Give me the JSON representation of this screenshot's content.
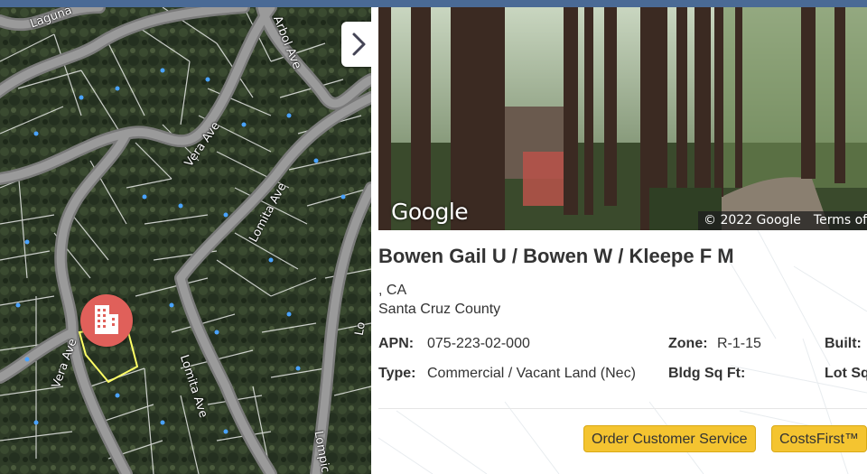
{
  "map": {
    "road_labels": [
      "Laguna",
      "Arbol Ave",
      "Vera Ave",
      "Lomita Ave",
      "Vera Ave",
      "Lomita Ave",
      "Lo",
      "Lompic"
    ],
    "marker_icon": "building-icon",
    "next_icon": "chevron-right-icon",
    "colors": {
      "marker": "#e0605a",
      "parcel_outline": "#ffff66",
      "road": "#8f8f8f"
    }
  },
  "street_view": {
    "logo": "Google",
    "copyright": "© 2022 Google",
    "terms": "Terms of"
  },
  "property": {
    "owner": "Bowen Gail U / Bowen W / Kleepe F M",
    "address_line": ", CA",
    "county": "Santa Cruz County",
    "fields": {
      "apn_label": "APN:",
      "apn_value": "075-223-02-000",
      "zone_label": "Zone:",
      "zone_value": "R-1-15",
      "built_label": "Built:",
      "type_label": "Type:",
      "type_value": "Commercial / Vacant Land (Nec)",
      "bldg_sqft_label": "Bldg Sq Ft:",
      "lot_sqft_label": "Lot Sq"
    }
  },
  "actions": {
    "order_label": "Order Customer Service",
    "costs_label": "CostsFirst™",
    "button_color": "#f4c430"
  }
}
